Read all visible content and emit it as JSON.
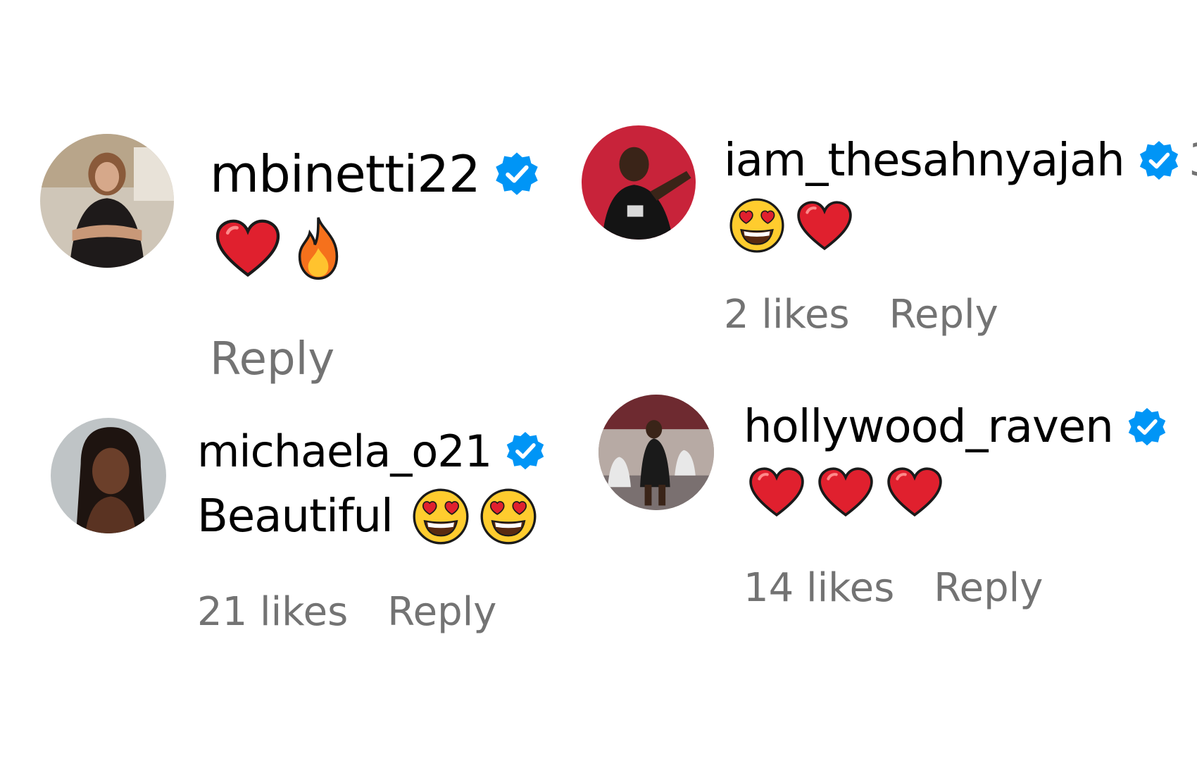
{
  "comments": [
    {
      "username": "mbinetti22",
      "verified": true,
      "text": "",
      "emojis": [
        "red-heart",
        "fire"
      ],
      "likes": "",
      "reply_label": "Reply"
    },
    {
      "username": "iam_thesahnyajah",
      "verified": true,
      "text": "",
      "emojis": [
        "heart-eyes",
        "red-heart"
      ],
      "likes": "2 likes",
      "reply_label": "Reply",
      "cut_off_text": "3"
    },
    {
      "username": "michaela_o21",
      "verified": true,
      "text": "Beautiful",
      "emojis": [
        "heart-eyes",
        "heart-eyes"
      ],
      "likes": "21 likes",
      "reply_label": "Reply"
    },
    {
      "username": "hollywood_raven",
      "verified": true,
      "text": "",
      "emojis": [
        "red-heart",
        "red-heart",
        "red-heart"
      ],
      "likes": "14 likes",
      "reply_label": "Reply"
    }
  ],
  "colors": {
    "verified_blue": "#0095F6",
    "meta_gray": "#737373",
    "heart_red": "#E0202E"
  }
}
